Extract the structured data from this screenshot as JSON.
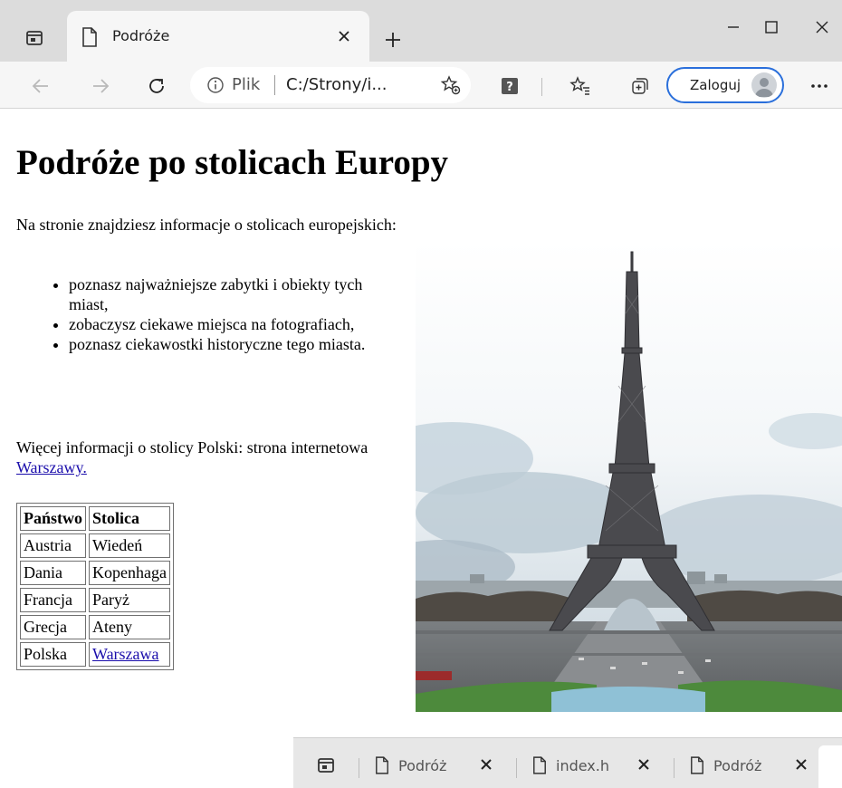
{
  "browser": {
    "tab": {
      "title": "Podróże"
    },
    "address": {
      "scheme_label": "Plik",
      "url": "C:/Strony/i..."
    },
    "signin_label": "Zaloguj"
  },
  "page": {
    "title": "Podróże po stolicach Europy",
    "intro": "Na stronie znajdziesz informacje o stolicach europejskich:",
    "features": [
      "poznasz najważniejsze zabytki i obiekty tych miast,",
      "zobaczysz ciekawe miejsca na fotografiach,",
      "poznasz ciekawostki historyczne tego miasta."
    ],
    "more_info_text": "Więcej informacji o stolicy Polski: strona internetowa ",
    "more_info_link": "Warszawy.",
    "table": {
      "headers": [
        "Państwo",
        "Stolica"
      ],
      "rows": [
        [
          "Austria",
          "Wiedeń"
        ],
        [
          "Dania",
          "Kopenhaga"
        ],
        [
          "Francja",
          "Paryż"
        ],
        [
          "Grecja",
          "Ateny"
        ],
        [
          "Polska",
          "Warszawa"
        ]
      ]
    }
  },
  "taskbar": {
    "items": [
      {
        "label": "Podróż"
      },
      {
        "label": "index.h"
      },
      {
        "label": "Podróż"
      }
    ]
  },
  "colors": {
    "accent": "#2a6fdb",
    "link": "#1a0dab",
    "chrome": "#dcdcdc"
  }
}
